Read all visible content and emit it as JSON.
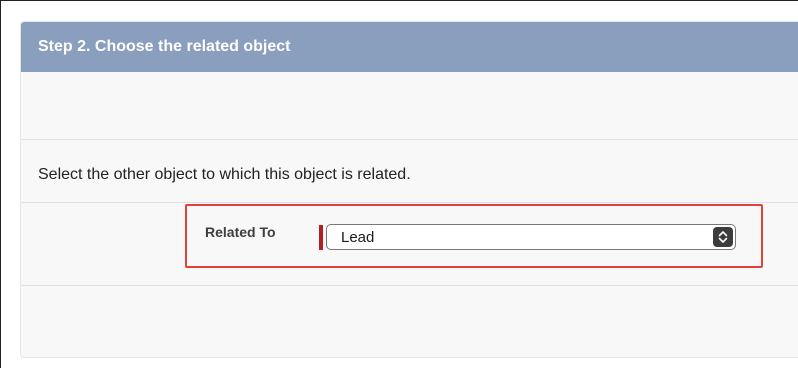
{
  "step": {
    "title": "Step 2. Choose the related object"
  },
  "instruction": "Select the other object to which this object is related.",
  "related_field": {
    "label": "Related To",
    "selected_value": "Lead",
    "required": true
  },
  "colors": {
    "header_bg": "#8a9ebe",
    "highlight_border": "#e0413b",
    "required_indicator": "#b21f24"
  },
  "icons": {
    "select_arrow": "chevron-up-down-icon"
  }
}
